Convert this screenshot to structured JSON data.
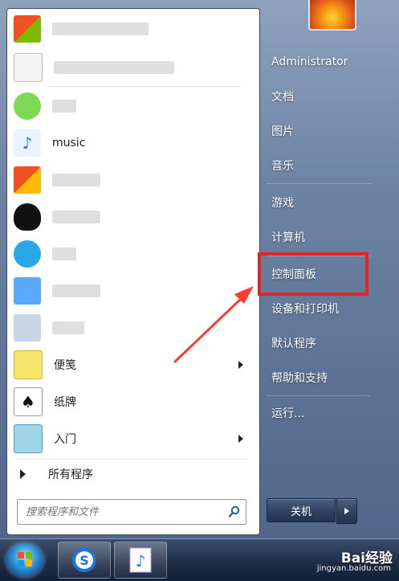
{
  "left_panel": {
    "programs": [
      {
        "label": "",
        "icon": "colorful-app-icon"
      },
      {
        "label": "",
        "icon": "document-icon"
      },
      {
        "label": "",
        "icon": "chat-icon"
      },
      {
        "label": "music",
        "icon": "music-note-icon"
      },
      {
        "label": "",
        "icon": "colorful-app-icon"
      },
      {
        "label": "",
        "icon": "penguin-icon"
      },
      {
        "label": "",
        "icon": "cloud-app-icon"
      },
      {
        "label": "",
        "icon": "butterfly-icon"
      },
      {
        "label": "",
        "icon": "video-app-icon"
      },
      {
        "label": "便笺",
        "icon": "sticky-note-icon",
        "has_submenu": true
      },
      {
        "label": "纸牌",
        "icon": "cards-icon",
        "has_submenu": false
      },
      {
        "label": "入门",
        "icon": "getting-started-icon",
        "has_submenu": true
      }
    ],
    "all_programs": "所有程序",
    "search_placeholder": "搜索程序和文件"
  },
  "right_panel": {
    "items": [
      {
        "label": "Administrator"
      },
      {
        "label": "文档"
      },
      {
        "label": "图片"
      },
      {
        "label": "音乐"
      },
      {
        "label": "游戏"
      },
      {
        "label": "计算机"
      },
      {
        "label": "控制面板"
      },
      {
        "label": "设备和打印机"
      },
      {
        "label": "默认程序"
      },
      {
        "label": "帮助和支持"
      },
      {
        "label": "运行..."
      }
    ],
    "shutdown_label": "关机"
  },
  "watermark": {
    "brand": "Bai经验",
    "url": "jingyan.baidu.com"
  },
  "colors": {
    "highlight": "#e52525",
    "arrow": "#ff3b30"
  }
}
